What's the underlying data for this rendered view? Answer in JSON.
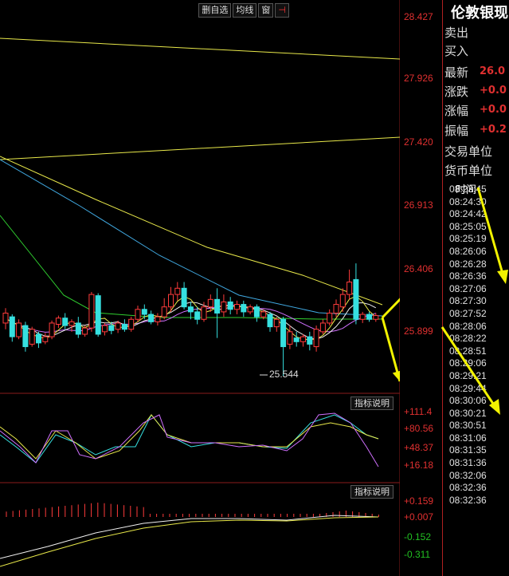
{
  "toolbar": {
    "delete_self_select": "删自选",
    "ma_line": "均线",
    "window": "窗",
    "pin": "⊣"
  },
  "price_axis": [
    "28.427",
    "27.926",
    "27.420",
    "26.913",
    "26.406",
    "25.899"
  ],
  "low_marker": "25.544",
  "indicator1": {
    "button": "指标说明",
    "labels": [
      "+111.4",
      "+80.56",
      "+48.37",
      "+16.18"
    ]
  },
  "indicator2": {
    "button": "指标说明",
    "labels": [
      "+0.159",
      "+0.007",
      "-0.152",
      "-0.311"
    ]
  },
  "panel": {
    "title": "伦敦银现",
    "rows": [
      {
        "label": "卖出",
        "value": ""
      },
      {
        "label": "买入",
        "value": ""
      },
      {
        "label": "最新",
        "value": "26.0"
      },
      {
        "label": "涨跌",
        "value": "+0.0"
      },
      {
        "label": "涨幅",
        "value": "+0.0"
      },
      {
        "label": "振幅",
        "value": "+0.2"
      },
      {
        "label": "交易单位",
        "value": ""
      },
      {
        "label": "货币单位",
        "value": ""
      }
    ],
    "time_header": "时间",
    "times": [
      "08:23:45",
      "08:24:30",
      "08:24:42",
      "08:25:05",
      "08:25:19",
      "08:26:06",
      "08:26:28",
      "08:26:36",
      "08:27:06",
      "08:27:30",
      "08:27:52",
      "08:28:06",
      "08:28:22",
      "08:28:51",
      "08:29:06",
      "08:29:21",
      "08:29:44",
      "08:30:06",
      "08:30:21",
      "08:30:51",
      "08:31:06",
      "08:31:35",
      "08:31:36",
      "08:32:06",
      "08:32:36",
      "08:32:36"
    ]
  },
  "colors": {
    "up": "#ff3b3b",
    "down": "#36e0e0",
    "ma_yellow": "#e8e84a",
    "ma_white": "#f0f0f0",
    "ma_purple": "#d070ff",
    "ma_green": "#30d030",
    "ma_blue": "#40a8e0",
    "arrow": "#f2f200",
    "grid_red": "#8a1b1b"
  },
  "chart_data": {
    "type": "candlestick",
    "y_range": [
      25.4,
      28.5
    ],
    "candles": [
      {
        "o": 25.97,
        "c": 26.05,
        "h": 26.09,
        "l": 25.92
      },
      {
        "o": 26.02,
        "c": 25.86,
        "h": 26.04,
        "l": 25.82
      },
      {
        "o": 25.86,
        "c": 25.97,
        "h": 26.0,
        "l": 25.84
      },
      {
        "o": 25.95,
        "c": 25.78,
        "h": 25.98,
        "l": 25.74
      },
      {
        "o": 25.8,
        "c": 25.92,
        "h": 25.94,
        "l": 25.78
      },
      {
        "o": 25.88,
        "c": 25.81,
        "h": 25.9,
        "l": 25.77
      },
      {
        "o": 25.82,
        "c": 25.86,
        "h": 25.89,
        "l": 25.8
      },
      {
        "o": 25.86,
        "c": 25.97,
        "h": 25.99,
        "l": 25.84
      },
      {
        "o": 25.96,
        "c": 26.01,
        "h": 26.03,
        "l": 25.93
      },
      {
        "o": 26.01,
        "c": 25.95,
        "h": 26.05,
        "l": 25.92
      },
      {
        "o": 25.95,
        "c": 25.98,
        "h": 26.0,
        "l": 25.9
      },
      {
        "o": 25.97,
        "c": 25.88,
        "h": 26.02,
        "l": 25.85
      },
      {
        "o": 25.88,
        "c": 25.93,
        "h": 25.95,
        "l": 25.86
      },
      {
        "o": 25.93,
        "c": 26.2,
        "h": 26.22,
        "l": 25.9
      },
      {
        "o": 26.19,
        "c": 25.88,
        "h": 26.21,
        "l": 25.86
      },
      {
        "o": 25.9,
        "c": 25.95,
        "h": 25.97,
        "l": 25.87
      },
      {
        "o": 25.95,
        "c": 25.91,
        "h": 25.98,
        "l": 25.88
      },
      {
        "o": 25.92,
        "c": 25.97,
        "h": 25.99,
        "l": 25.89
      },
      {
        "o": 25.96,
        "c": 25.92,
        "h": 26.0,
        "l": 25.9
      },
      {
        "o": 25.92,
        "c": 26.0,
        "h": 26.02,
        "l": 25.9
      },
      {
        "o": 26.0,
        "c": 26.08,
        "h": 26.11,
        "l": 25.98
      },
      {
        "o": 26.08,
        "c": 26.04,
        "h": 26.12,
        "l": 26.0
      },
      {
        "o": 26.04,
        "c": 25.98,
        "h": 26.07,
        "l": 25.96
      },
      {
        "o": 25.98,
        "c": 26.02,
        "h": 26.05,
        "l": 25.95
      },
      {
        "o": 26.02,
        "c": 26.1,
        "h": 26.17,
        "l": 26.0
      },
      {
        "o": 26.1,
        "c": 26.2,
        "h": 26.26,
        "l": 26.06
      },
      {
        "o": 26.2,
        "c": 26.25,
        "h": 26.3,
        "l": 26.15
      },
      {
        "o": 26.25,
        "c": 26.1,
        "h": 26.3,
        "l": 26.08
      },
      {
        "o": 26.1,
        "c": 26.06,
        "h": 26.14,
        "l": 26.0
      },
      {
        "o": 26.06,
        "c": 26.0,
        "h": 26.1,
        "l": 25.96
      },
      {
        "o": 26.0,
        "c": 26.1,
        "h": 26.14,
        "l": 25.98
      },
      {
        "o": 26.1,
        "c": 26.16,
        "h": 26.2,
        "l": 26.06
      },
      {
        "o": 26.16,
        "c": 26.05,
        "h": 26.25,
        "l": 25.85
      },
      {
        "o": 26.06,
        "c": 26.14,
        "h": 26.2,
        "l": 26.02
      },
      {
        "o": 26.14,
        "c": 26.08,
        "h": 26.18,
        "l": 26.04
      },
      {
        "o": 26.08,
        "c": 26.12,
        "h": 26.15,
        "l": 26.04
      },
      {
        "o": 26.12,
        "c": 26.06,
        "h": 26.15,
        "l": 26.02
      },
      {
        "o": 26.06,
        "c": 26.1,
        "h": 26.12,
        "l": 26.04
      },
      {
        "o": 26.1,
        "c": 26.02,
        "h": 26.12,
        "l": 25.98
      },
      {
        "o": 26.02,
        "c": 26.06,
        "h": 26.08,
        "l": 26.0
      },
      {
        "o": 26.04,
        "c": 25.94,
        "h": 26.06,
        "l": 25.9
      },
      {
        "o": 25.94,
        "c": 26.0,
        "h": 26.02,
        "l": 25.9
      },
      {
        "o": 26.0,
        "c": 25.78,
        "h": 26.02,
        "l": 25.544
      },
      {
        "o": 25.8,
        "c": 25.9,
        "h": 25.95,
        "l": 25.76
      },
      {
        "o": 25.85,
        "c": 25.82,
        "h": 25.9,
        "l": 25.78
      },
      {
        "o": 25.82,
        "c": 25.86,
        "h": 25.88,
        "l": 25.78
      },
      {
        "o": 25.86,
        "c": 25.8,
        "h": 25.9,
        "l": 25.75
      },
      {
        "o": 25.78,
        "c": 25.92,
        "h": 25.95,
        "l": 25.74
      },
      {
        "o": 25.9,
        "c": 25.97,
        "h": 26.0,
        "l": 25.88
      },
      {
        "o": 25.97,
        "c": 26.05,
        "h": 26.08,
        "l": 25.95
      },
      {
        "o": 26.05,
        "c": 26.12,
        "h": 26.16,
        "l": 26.02
      },
      {
        "o": 26.1,
        "c": 26.2,
        "h": 26.25,
        "l": 26.06
      },
      {
        "o": 26.2,
        "c": 26.3,
        "h": 26.4,
        "l": 26.16
      },
      {
        "o": 26.32,
        "c": 26.0,
        "h": 26.45,
        "l": 25.96
      },
      {
        "o": 26.0,
        "c": 26.04,
        "h": 26.06,
        "l": 25.97
      },
      {
        "o": 26.04,
        "c": 26.0,
        "h": 26.06,
        "l": 25.98
      },
      {
        "o": 26.0,
        "c": 26.03,
        "h": 26.05,
        "l": 25.98
      }
    ]
  }
}
